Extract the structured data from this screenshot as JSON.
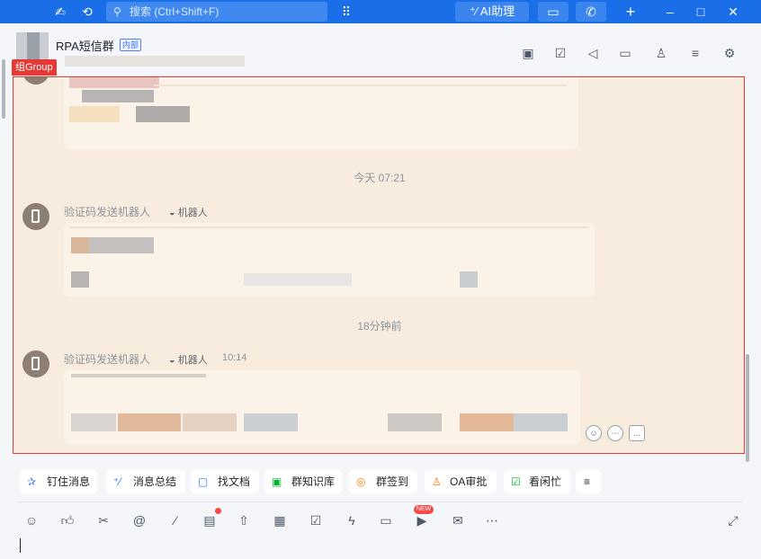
{
  "topbar": {
    "search_placeholder": "搜索 (Ctrl+Shift+F)",
    "ai_label": "AI助理",
    "icons": [
      "app-logo-icon",
      "history-icon",
      "search-icon",
      "apps-grid-icon",
      "ai-assistant-icon",
      "screen-share-icon",
      "call-icon",
      "plus-icon",
      "minimize-icon",
      "maximize-icon",
      "close-icon"
    ]
  },
  "header": {
    "title": "RPA短信群",
    "badge": "内部",
    "group_tag": "组Group"
  },
  "chat": {
    "time_1": "今天 07:21",
    "time_2": "18分钟前",
    "messages": [
      {
        "sender": "验证码发送机器人",
        "bot_label": "机器人",
        "time": ""
      },
      {
        "sender": "验证码发送机器人",
        "bot_label": "机器人",
        "time": "10:14"
      }
    ]
  },
  "quick_actions": [
    {
      "label": "钉住消息",
      "icon": "pin-icon",
      "glyph": "✰"
    },
    {
      "label": "消息总结",
      "icon": "summary-icon",
      "glyph": "⁺⁄"
    },
    {
      "label": "找文档",
      "icon": "find-doc-icon",
      "glyph": "▢"
    },
    {
      "label": "群知识库",
      "icon": "knowledge-base-icon",
      "glyph": "▣"
    },
    {
      "label": "群签到",
      "icon": "checkin-icon",
      "glyph": "◎"
    },
    {
      "label": "OA审批",
      "icon": "approval-icon",
      "glyph": "♙"
    },
    {
      "label": "看闲忙",
      "icon": "calendar-free-busy-icon",
      "glyph": "☑"
    }
  ],
  "composer": {
    "new_badge": "NEW"
  }
}
